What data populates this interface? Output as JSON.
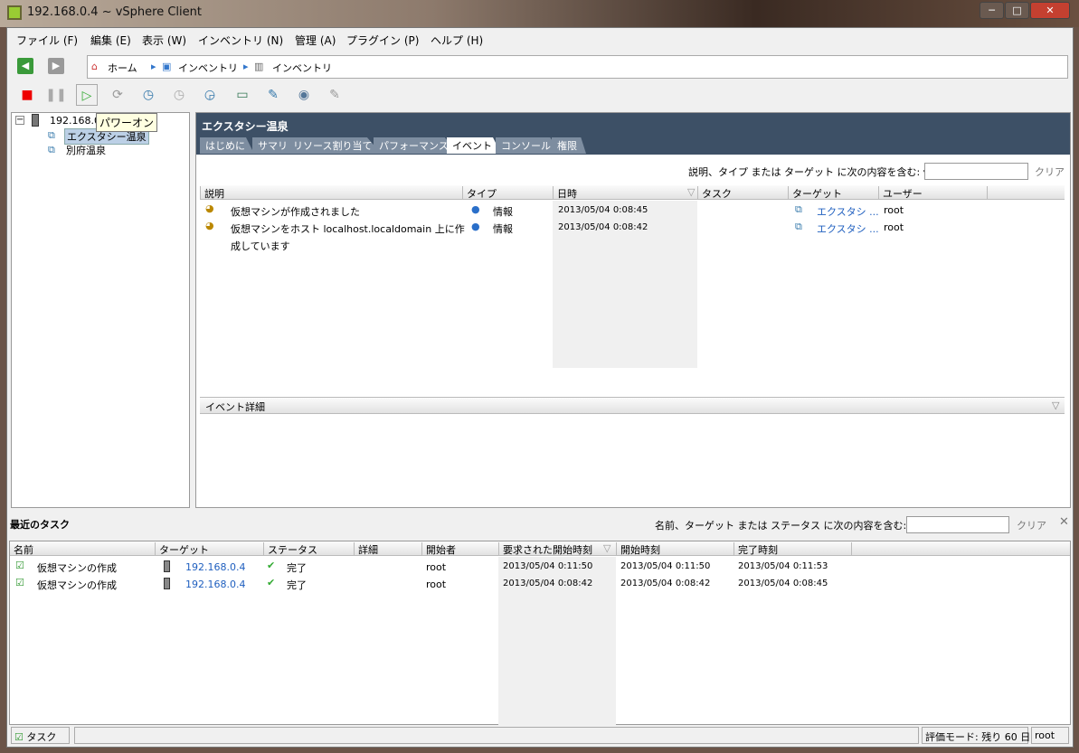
{
  "window": {
    "title": "192.168.0.4 ~ vSphere Client",
    "min": "─",
    "max": "□",
    "close": "✕"
  },
  "menu": [
    "ファイル (F)",
    "編集 (E)",
    "表示 (W)",
    "インベントリ (N)",
    "管理 (A)",
    "プラグイン (P)",
    "ヘルプ (H)"
  ],
  "breadcrumb": [
    "ホーム",
    "インベントリ",
    "インベントリ"
  ],
  "tooltip": "パワーオン",
  "tree": {
    "host": "192.168.0.4",
    "vms": [
      "エクスタシー温泉",
      "別府温泉"
    ]
  },
  "main": {
    "title": "エクスタシー温泉",
    "tabs": [
      "はじめに",
      "サマリ",
      "リソース割り当て",
      "パフォーマンス",
      "イベント",
      "コンソール",
      "権限"
    ],
    "filter_label": "説明、タイプ または ターゲット に次の内容を含む: ▾",
    "filter_value": "",
    "clear": "クリア",
    "columns": [
      "説明",
      "タイプ",
      "日時",
      "タスク",
      "ターゲット",
      "ユーザー"
    ],
    "events": [
      {
        "desc": "仮想マシンが作成されました",
        "desc2": "",
        "type": "情報",
        "time": "2013/05/04 0:08:45",
        "task": "",
        "target": "エクスタシ ...",
        "user": "root"
      },
      {
        "desc": "仮想マシンをホスト localhost.localdomain 上に作",
        "desc2": "成しています",
        "type": "情報",
        "time": "2013/05/04 0:08:42",
        "task": "",
        "target": "エクスタシ ...",
        "user": "root"
      }
    ],
    "detail_title": "イベント詳細"
  },
  "tasks": {
    "title": "最近のタスク",
    "filter_label": "名前、ターゲット または ステータス に次の内容を含む: ▾",
    "filter_value": "",
    "clear": "クリア",
    "columns": [
      "名前",
      "ターゲット",
      "ステータス",
      "詳細",
      "開始者",
      "要求された開始時刻",
      "開始時刻",
      "完了時刻"
    ],
    "rows": [
      {
        "name": "仮想マシンの作成",
        "target": "192.168.0.4",
        "status": "完了",
        "detail": "",
        "by": "root",
        "req": "2013/05/04 0:11:50",
        "start": "2013/05/04 0:11:50",
        "end": "2013/05/04 0:11:53"
      },
      {
        "name": "仮想マシンの作成",
        "target": "192.168.0.4",
        "status": "完了",
        "detail": "",
        "by": "root",
        "req": "2013/05/04 0:08:42",
        "start": "2013/05/04 0:08:42",
        "end": "2013/05/04 0:08:45"
      }
    ]
  },
  "statusbar": {
    "tasks": "タスク",
    "eval": "評価モード: 残り 60 日",
    "user": "root"
  }
}
